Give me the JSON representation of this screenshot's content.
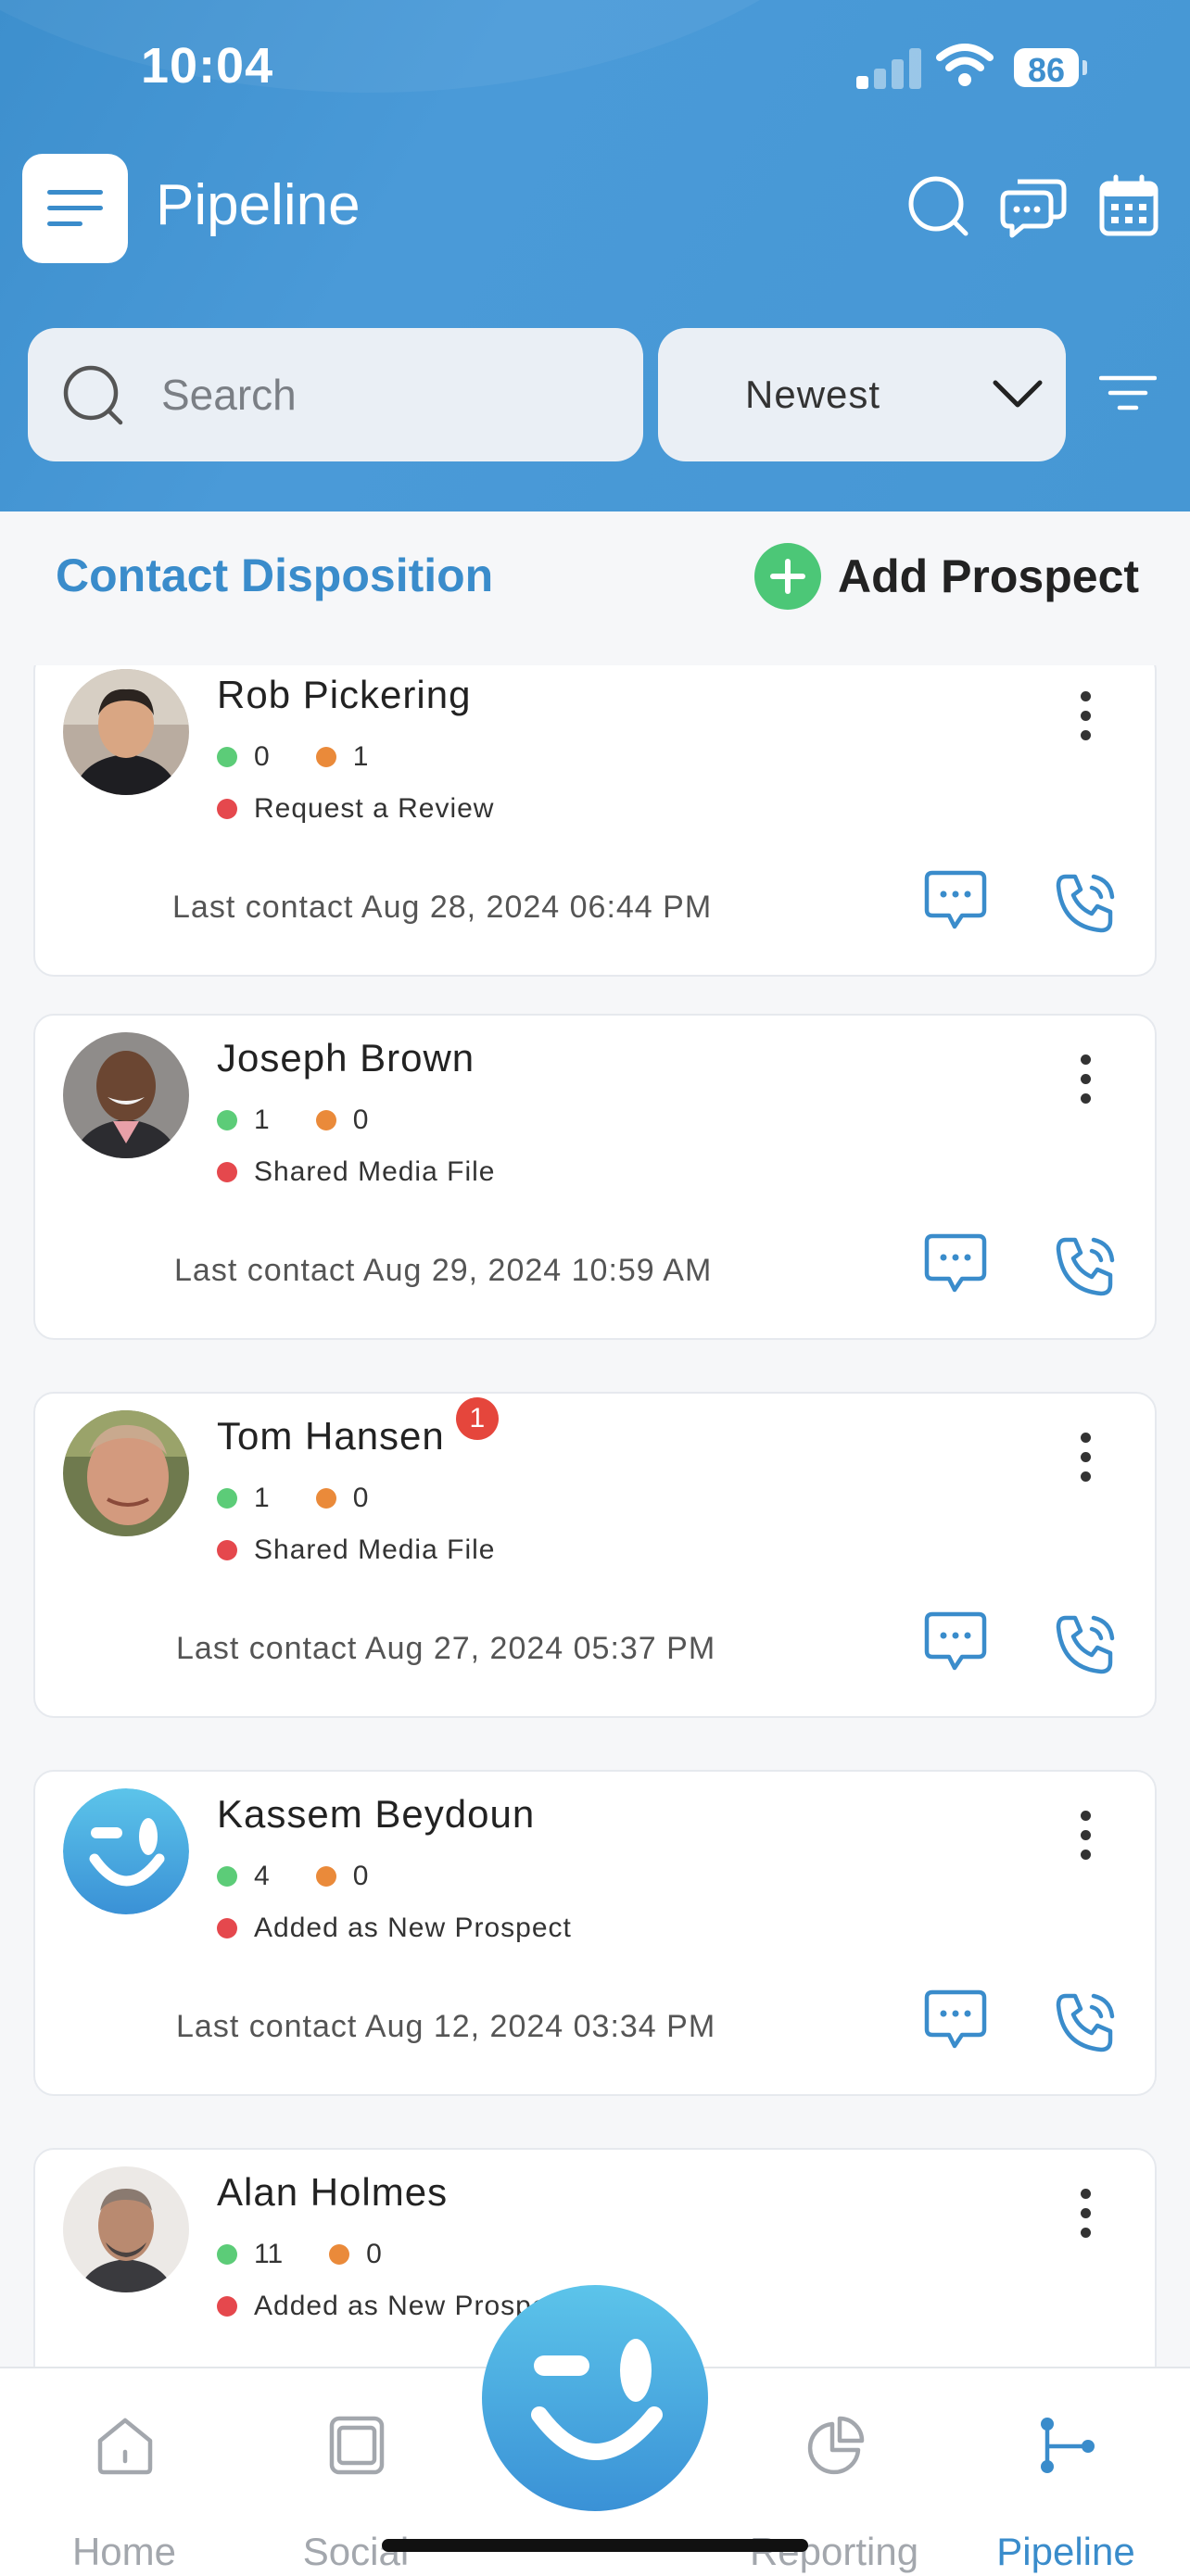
{
  "status_bar": {
    "time": "10:04",
    "battery": "86"
  },
  "header": {
    "title": "Pipeline"
  },
  "search": {
    "placeholder": "Search"
  },
  "sort": {
    "selected": "Newest"
  },
  "section": {
    "title": "Contact Disposition",
    "add_label": "Add Prospect"
  },
  "contacts": [
    {
      "name": "Rob Pickering",
      "green_count": "0",
      "orange_count": "1",
      "disposition": "Request a Review",
      "last_contact": "Last contact Aug 28, 2024 06:44 PM",
      "badge": ""
    },
    {
      "name": "Joseph Brown",
      "green_count": "1",
      "orange_count": "0",
      "disposition": "Shared Media File",
      "last_contact": "Last contact Aug 29, 2024 10:59 AM",
      "badge": ""
    },
    {
      "name": "Tom Hansen",
      "green_count": "1",
      "orange_count": "0",
      "disposition": "Shared Media File",
      "last_contact": "Last contact Aug 27, 2024 05:37 PM",
      "badge": "1"
    },
    {
      "name": "Kassem Beydoun",
      "green_count": "4",
      "orange_count": "0",
      "disposition": "Added as New Prospect",
      "last_contact": "Last contact Aug 12, 2024 03:34 PM",
      "badge": ""
    },
    {
      "name": "Alan Holmes",
      "green_count": "11",
      "orange_count": "0",
      "disposition": "Added as New Prospect",
      "last_contact": "",
      "badge": ""
    }
  ],
  "tabs": [
    {
      "label": "Home"
    },
    {
      "label": "Social"
    },
    {
      "label": "Reporting"
    },
    {
      "label": "Pipeline"
    }
  ],
  "colors": {
    "header_blue": "#4697d4",
    "accent_blue": "#3a8ccb",
    "green_status": "#5ccc78",
    "orange_status": "#ea8a3a",
    "red_status": "#e5484d",
    "badge_red": "#e5463c"
  }
}
